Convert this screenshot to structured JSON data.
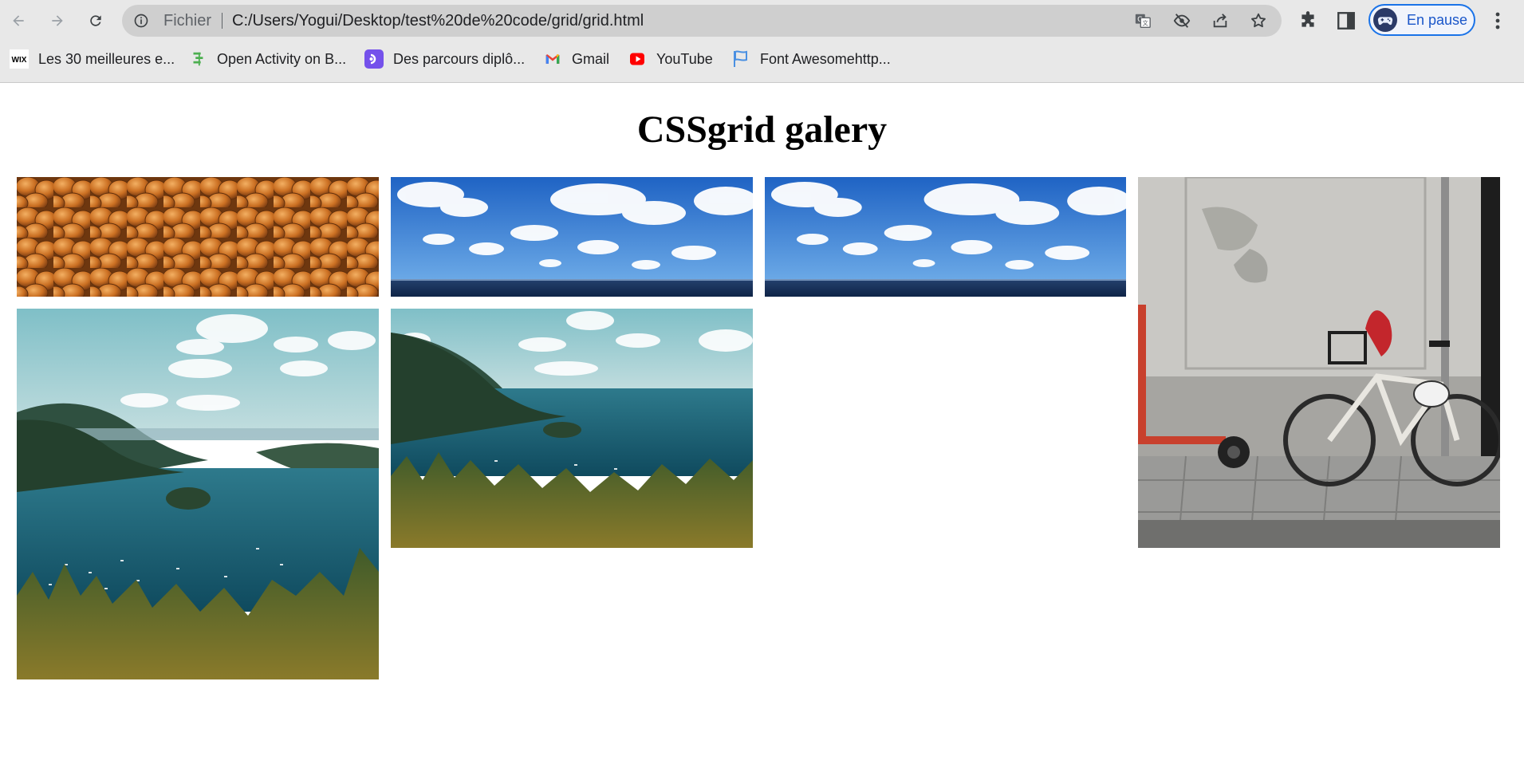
{
  "browser": {
    "address_scheme": "Fichier",
    "address_url": "C:/Users/Yogui/Desktop/test%20de%20code/grid/grid.html",
    "profile_label": "En pause",
    "accent_color": "#1a73e8",
    "bookmarks": [
      {
        "label": "Les 30 meilleures e...",
        "icon": "wix-icon"
      },
      {
        "label": "Open Activity on B...",
        "icon": "board-icon"
      },
      {
        "label": "Des parcours diplô...",
        "icon": "openclassrooms-icon"
      },
      {
        "label": "Gmail",
        "icon": "gmail-icon"
      },
      {
        "label": "YouTube",
        "icon": "youtube-icon"
      },
      {
        "label": "Font Awesomehttp...",
        "icon": "flag-icon"
      }
    ],
    "toolbar_icons": [
      "back-icon",
      "forward-icon",
      "reload-icon",
      "info-icon",
      "translate-icon",
      "eye-off-icon",
      "share-icon",
      "star-icon",
      "extensions-icon",
      "side-panel-icon",
      "kebab-menu-icon"
    ]
  },
  "page": {
    "title": "CSSgrid galery",
    "images": [
      {
        "name": "pennies-photo"
      },
      {
        "name": "sky-sea-photo-1"
      },
      {
        "name": "sky-sea-photo-2"
      },
      {
        "name": "bicycle-street-photo"
      },
      {
        "name": "lake-forest-photo-tall"
      },
      {
        "name": "lake-forest-photo-wide"
      }
    ]
  }
}
